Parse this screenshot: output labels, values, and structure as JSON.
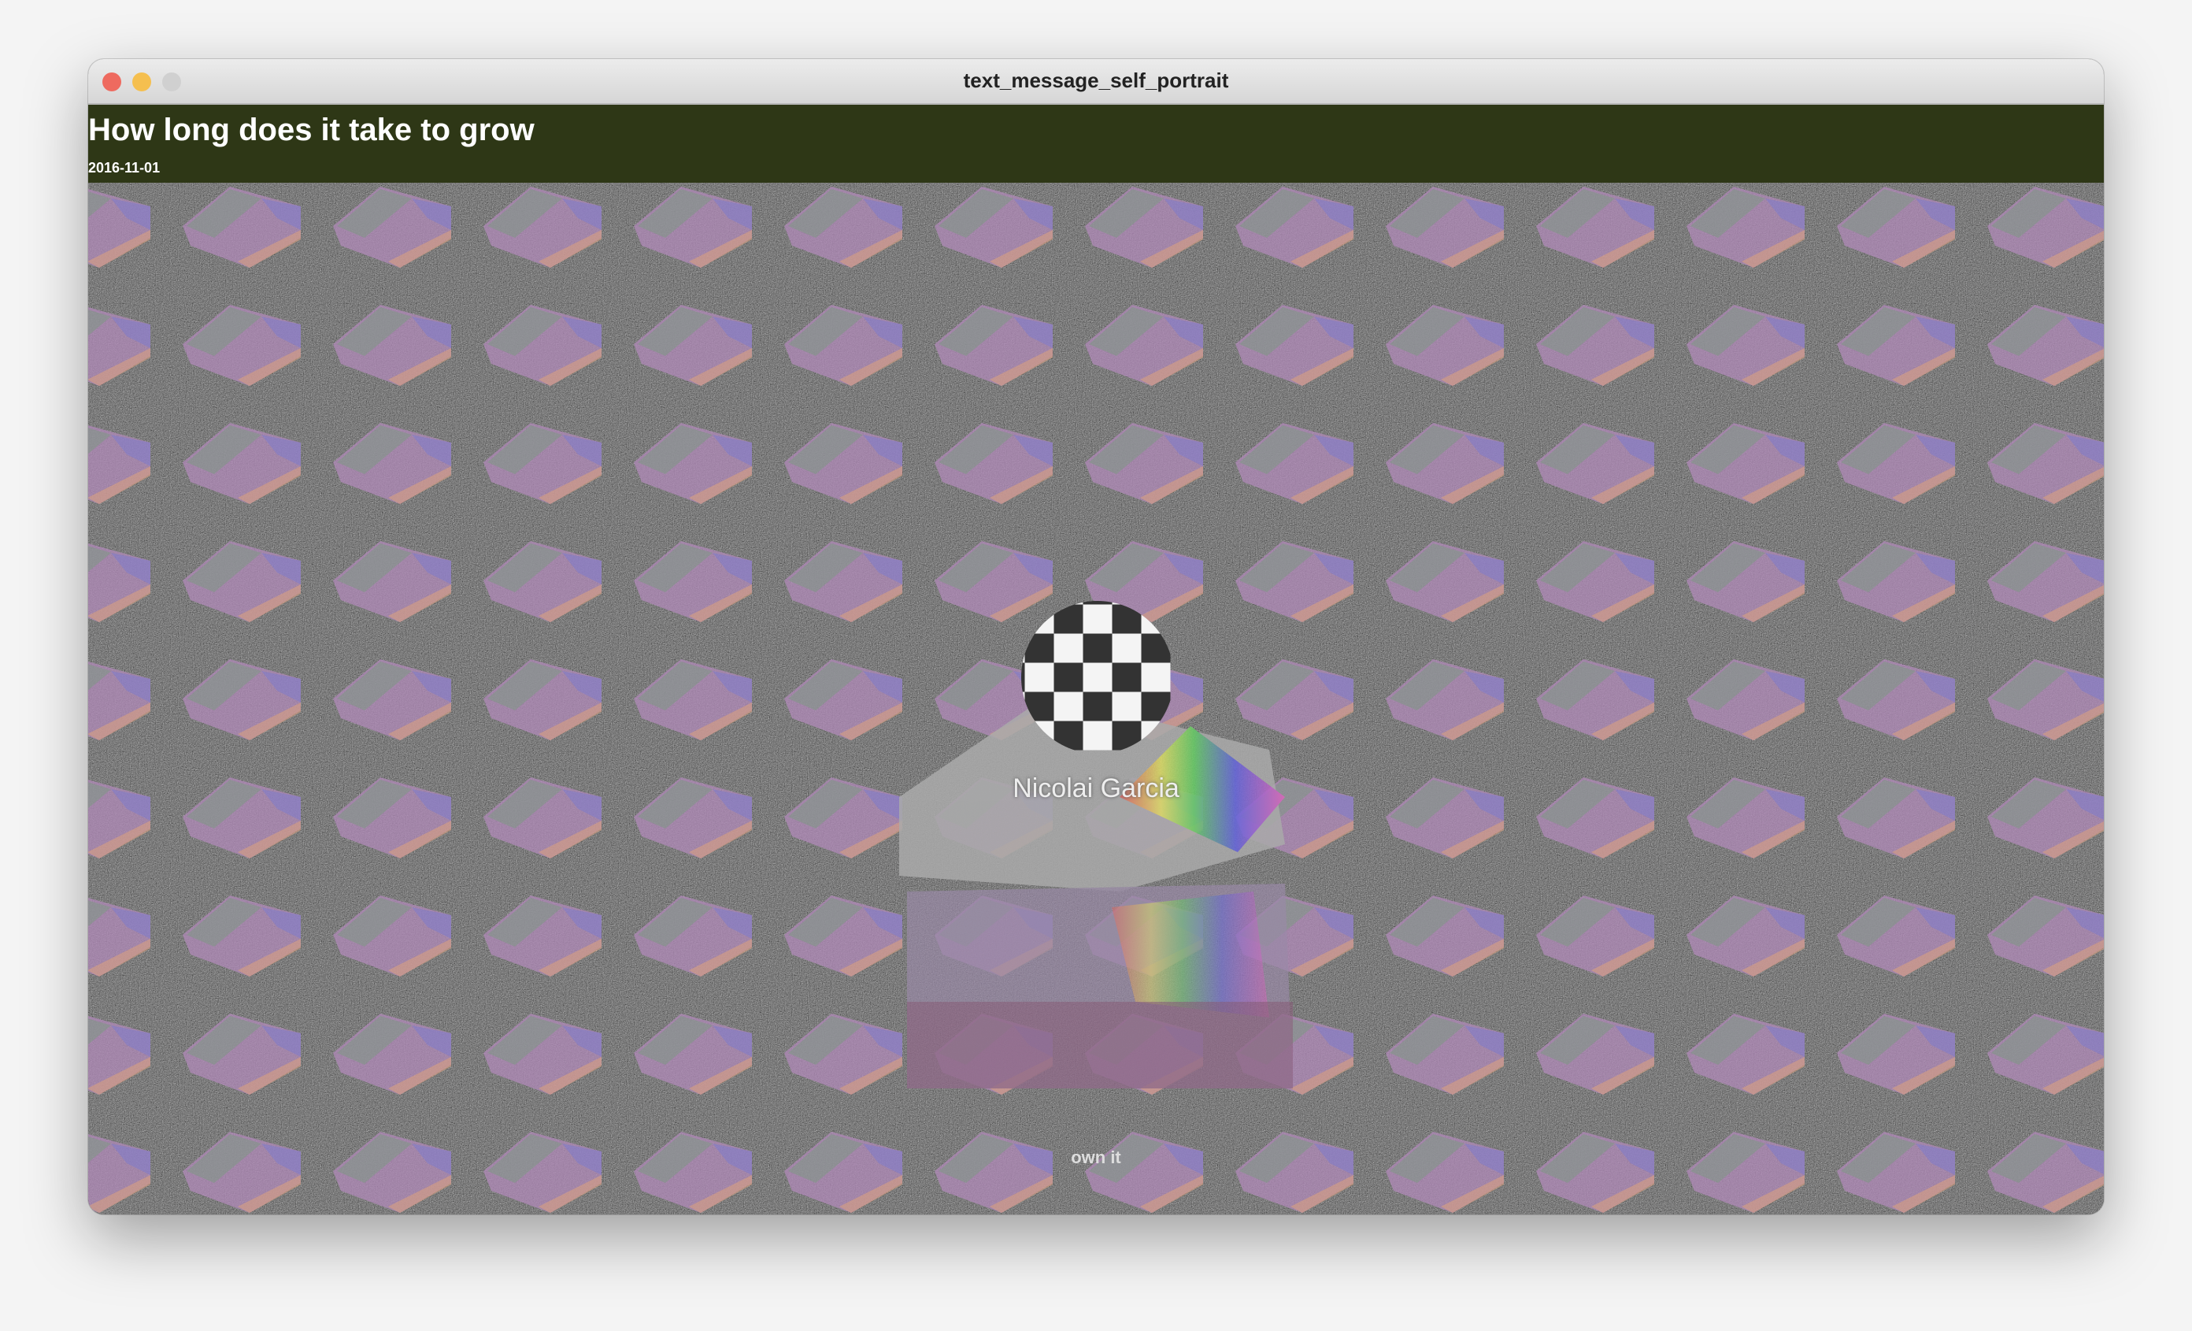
{
  "window": {
    "title": "text_message_self_portrait"
  },
  "header": {
    "title": "How long does it take to grow",
    "date": "2016-11-01"
  },
  "artwork": {
    "name": "Nicolai Garcia",
    "caption": "own it"
  },
  "colors": {
    "header_bg": "#2e3716",
    "close": "#ee6a5f",
    "minimize": "#f5bf4f",
    "zoom": "#d0d0d0"
  }
}
